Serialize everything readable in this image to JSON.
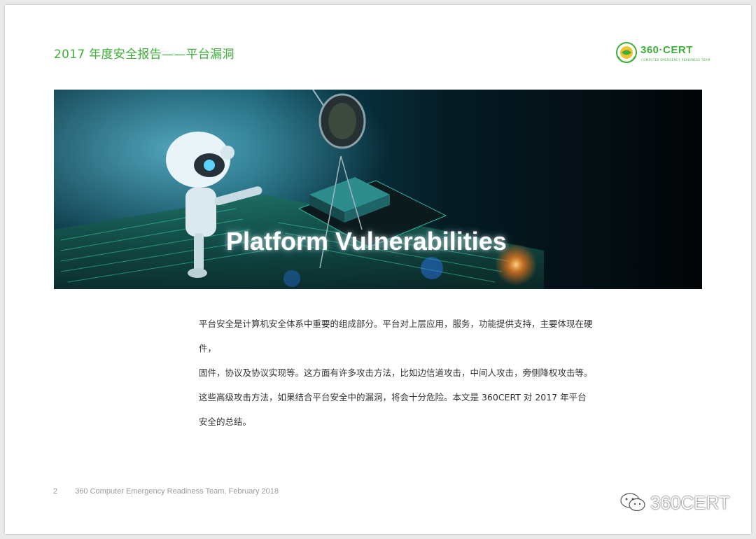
{
  "header": {
    "title": "2017 年度安全报告——平台漏洞",
    "logo_text": "360·CERT",
    "logo_sub": "COMPUTER EMERGENCY READINESS TEAM"
  },
  "hero": {
    "title": "Platform Vulnerabilities"
  },
  "body": {
    "lines": [
      "平台安全是计算机安全体系中重要的组成部分。平台对上层应用，服务，功能提供支持，主要体现在硬件，",
      "固件，协议及协议实现等。这方面有许多攻击方法，比如边信道攻击，中间人攻击，旁侧降权攻击等。",
      "这些高级攻击方法，如果结合平台安全中的漏洞，将会十分危险。本文是 360CERT 对 2017 年平台",
      "安全的总结。"
    ]
  },
  "footer": {
    "page_number": "2",
    "text": "360 Computer Emergency Readiness Team, February 2018"
  },
  "watermark": {
    "text": "360CERT",
    "icon": "wechat-icon"
  },
  "colors": {
    "brand_green": "#3fae3a",
    "hero_bg": "#02080c",
    "body_text": "#333333"
  }
}
